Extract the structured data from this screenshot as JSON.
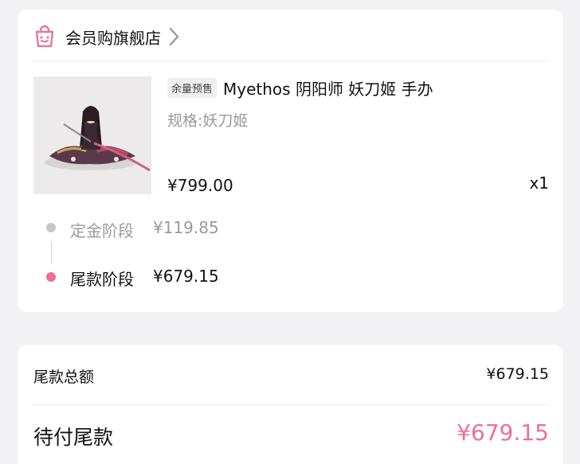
{
  "store": {
    "name": "会员购旗舰店",
    "icon": "shopping-bag-icon",
    "accent_color": "#e8769a"
  },
  "product": {
    "badge": "余量预售",
    "title": "Myethos 阴阳师 妖刀姬 手办",
    "spec": "规格:妖刀姬",
    "price": "¥799.00",
    "quantity": "x1",
    "image": "figure-product-image"
  },
  "stages": {
    "deposit": {
      "label": "定金阶段",
      "amount": "¥119.85",
      "color": "#c7c7c7"
    },
    "final": {
      "label": "尾款阶段",
      "amount": "¥679.15",
      "color": "#ee6f95"
    }
  },
  "summary": {
    "total_label": "尾款总额",
    "total_value": "¥679.15",
    "due_label": "待付尾款",
    "due_value": "¥679.15",
    "due_color": "#ee6f95"
  }
}
